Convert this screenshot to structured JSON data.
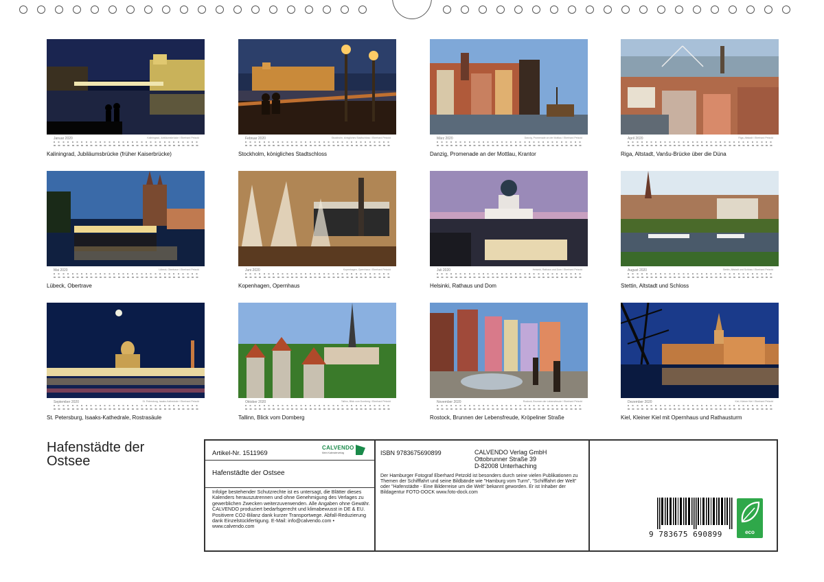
{
  "calendar": {
    "title_lines": [
      "Hafenstädte der",
      "Ostsee"
    ],
    "months": [
      {
        "month": "Januar 2020",
        "caption": "Kaliningrad, Jubiläumsbrücke (früher Kaiserbrücke)",
        "credit": "Kaliningrad, Jubiläumsbrücke / Eberhard Petzold"
      },
      {
        "month": "Februar 2020",
        "caption": "Stockholm, königliches Stadtschloss",
        "credit": "Stockholm, königliches Stadtschloss / Eberhard Petzold"
      },
      {
        "month": "März 2020",
        "caption": "Danzig, Promenade an der Mottlau, Krantor",
        "credit": "Danzig, Promenade an der Mottlau / Eberhard Petzold"
      },
      {
        "month": "April 2020",
        "caption": "Riga, Altstadt, Vanšu-Brücke über die Düna",
        "credit": "Riga, Altstadt / Eberhard Petzold"
      },
      {
        "month": "Mai 2020",
        "caption": "Lübeck, Obertrave",
        "credit": "Lübeck, Obertrave / Eberhard Petzold"
      },
      {
        "month": "Juni 2020",
        "caption": "Kopenhagen, Opernhaus",
        "credit": "Kopenhagen, Opernhaus / Eberhard Petzold"
      },
      {
        "month": "Juli 2020",
        "caption": "Helsinki, Rathaus und Dom",
        "credit": "Helsinki, Rathaus und Dom / Eberhard Petzold"
      },
      {
        "month": "August 2020",
        "caption": "Stettin, Altstadt und Schloss",
        "credit": "Stettin, Altstadt und Schloss / Eberhard Petzold"
      },
      {
        "month": "September 2020",
        "caption": "St. Petersburg, Isaaks-Kathedrale, Rostrasäule",
        "credit": "St. Petersburg, Isaaks-Kathedrale / Eberhard Petzold"
      },
      {
        "month": "Oktober 2020",
        "caption": "Tallinn, Blick vom Domberg",
        "credit": "Tallinn, Blick vom Domberg / Eberhard Petzold"
      },
      {
        "month": "November 2020",
        "caption": "Rostock, Brunnen der Lebensfreude, Kröpeliner Straße",
        "credit": "Rostock, Brunnen der Lebensfreude / Eberhard Petzold"
      },
      {
        "month": "Dezember 2020",
        "caption": "Kiel, Kleiner Kiel mit Opernhaus und Rathausturm",
        "credit": "Kiel, Kleiner Kiel / Eberhard Petzold"
      }
    ]
  },
  "info": {
    "article": "Artikel-Nr. 1511969",
    "logo": "CALVENDO",
    "logo_sub": "Mein Kalenderverlag",
    "subtitle": "Hafenstädte der Ostsee",
    "legal": "Infolge bestehender Schutzrechte ist es untersagt, die Blätter dieses Kalenders herauszutrennen und ohne Genehmigung des Verlages zu gewerblichen Zwecken weiterzuverwenden. Alle Angaben ohne Gewähr. CALVENDO produziert bedarfsgerecht und klimabewusst in DE & EU. Positivere CO2-Bilanz dank kurzer Transportwege. Abfall-Reduzierung dank Einzelstückfertigung. E-Mail: info@calvendo.com • www.calvendo.com",
    "isbn": "ISBN 9783675690899",
    "publisher": [
      "CALVENDO Verlag GmbH",
      "Ottobrunner Straße 39",
      "D-82008 Unterhaching"
    ],
    "about": "Der Hamburger Fotograf Eberhard Petzold ist besonders durch seine vielen Publikationen zu Themen der Schifffahrt und seine Bildbände wie \"Hamburg vom Turm\", \"Schifffahrt der Welt\" oder \"Hafenstädte - Eine Bilderreise um die Welt\" bekannt geworden. Er ist Inhaber der Bildagentur FOTO-DOCK www.foto-dock.com",
    "barcode_number": "9 783675 690899",
    "eco_label": "eco"
  },
  "colors": {
    "brand_green": "#1a8a4a",
    "eco_green": "#2fa84a",
    "border": "#333333"
  }
}
